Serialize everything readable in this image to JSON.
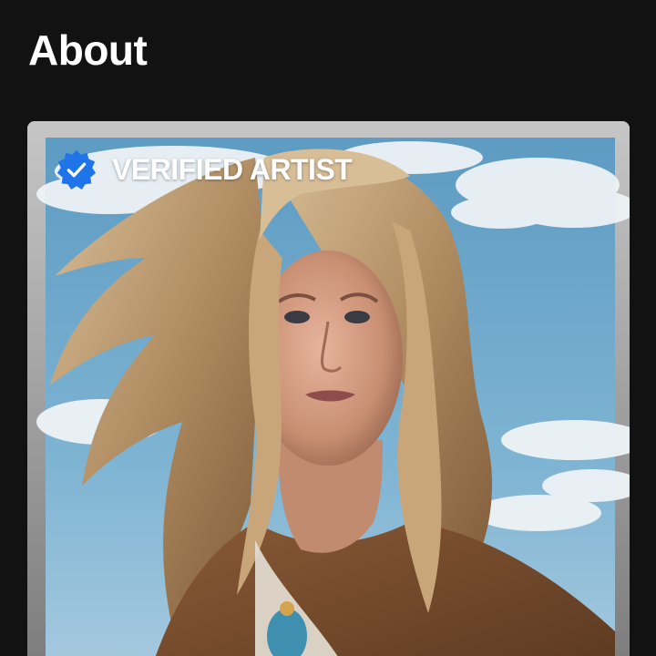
{
  "header": {
    "title": "About"
  },
  "artist_card": {
    "badge_label": "VERIFIED ARTIST",
    "badge_icon": "verified-check-icon",
    "colors": {
      "badge": "#1e74e8",
      "card_frame": "#b8b8b8",
      "sky": "#5fa3c8",
      "background": "#121212"
    }
  }
}
